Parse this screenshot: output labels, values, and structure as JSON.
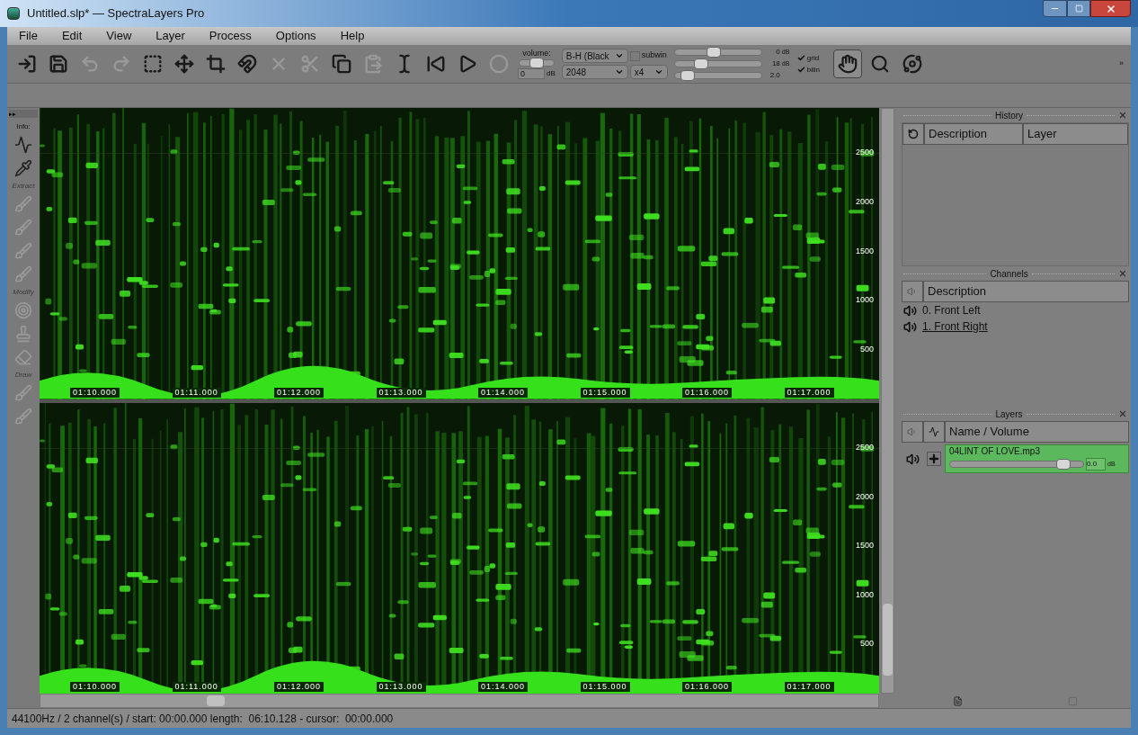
{
  "window": {
    "title": "Untitled.slp* — SpectraLayers Pro"
  },
  "menu": [
    "File",
    "Edit",
    "View",
    "Layer",
    "Process",
    "Options",
    "Help"
  ],
  "toolbar": {
    "buttons": [
      {
        "kind": "import",
        "disabled": false
      },
      {
        "kind": "save",
        "disabled": false
      },
      {
        "kind": "undo",
        "disabled": true
      },
      {
        "kind": "redo",
        "disabled": true
      },
      {
        "kind": "select",
        "disabled": false
      },
      {
        "kind": "move",
        "disabled": false
      },
      {
        "kind": "transform",
        "disabled": false
      },
      {
        "kind": "magnet",
        "disabled": false
      },
      {
        "kind": "delete",
        "disabled": true
      },
      {
        "kind": "cut",
        "disabled": true
      },
      {
        "kind": "copy",
        "disabled": false
      },
      {
        "kind": "paste",
        "disabled": true
      },
      {
        "kind": "cursor",
        "disabled": false
      },
      {
        "kind": "rewind",
        "disabled": false
      },
      {
        "kind": "play",
        "disabled": false
      },
      {
        "kind": "record",
        "disabled": true
      }
    ],
    "volume": {
      "label": "volume:",
      "level": 0.5,
      "value": "0",
      "unit": "dB"
    },
    "colormap": "B-H (Black",
    "fft_size": "2048",
    "overlap": "x4",
    "subwin": {
      "label": "subwin",
      "checked": false
    },
    "sliders": [
      {
        "level": 0.45,
        "value": "0",
        "unit": "dB"
      },
      {
        "level": 0.3,
        "value": "18",
        "unit": "dB"
      },
      {
        "level": 0.15,
        "value": "2.0"
      }
    ],
    "checkboxes": [
      {
        "label": "grid",
        "checked": true
      },
      {
        "label": "bilin",
        "checked": true
      }
    ],
    "tools": [
      {
        "kind": "hand",
        "selected": true
      },
      {
        "kind": "zoom",
        "selected": false
      },
      {
        "kind": "orbit",
        "selected": false
      }
    ],
    "overflow": "»"
  },
  "tool_panel": {
    "expand": "▸▸",
    "sections": [
      {
        "label": "Info:",
        "faded": false,
        "tools": [
          {
            "kind": "spectrum"
          },
          {
            "kind": "dropper"
          }
        ]
      },
      {
        "label": "Extract",
        "faded": true,
        "tools": [
          {
            "kind": "brush"
          },
          {
            "kind": "brush"
          },
          {
            "kind": "brush"
          },
          {
            "kind": "brush"
          }
        ]
      },
      {
        "label": "Modify",
        "faded": true,
        "tools": [
          {
            "kind": "circle"
          },
          {
            "kind": "stamp"
          },
          {
            "kind": "eraser"
          }
        ]
      },
      {
        "label": "Draw",
        "faded": true,
        "tools": [
          {
            "kind": "brush"
          },
          {
            "kind": "brush"
          }
        ]
      }
    ]
  },
  "spectrogram": {
    "channels": [
      {
        "freq_ticks": [
          "2500",
          "2000",
          "1500",
          "1000",
          "500"
        ],
        "time_labels": [
          "01:10.000",
          "01:11.000",
          "01:12.000",
          "01:13.000",
          "01:14.000",
          "01:15.000",
          "01:16.000",
          "01:17.000"
        ]
      },
      {
        "freq_ticks": [
          "2500",
          "2000",
          "1500",
          "1000",
          "500"
        ],
        "time_labels": [
          "01:10.000",
          "01:11.000",
          "01:12.000",
          "01:13.000",
          "01:14.000",
          "01:15.000",
          "01:16.000",
          "01:17.000"
        ]
      }
    ]
  },
  "history": {
    "title": "History",
    "columns": [
      "Description",
      "Layer"
    ]
  },
  "channels_panel": {
    "title": "Channels",
    "columns": [
      "Description"
    ],
    "rows": [
      {
        "label": "0. Front Left",
        "selected": false
      },
      {
        "label": "1. Front Right",
        "selected": true
      }
    ]
  },
  "layers": {
    "title": "Layers",
    "columns": [
      "Name / Volume"
    ],
    "rows": [
      {
        "name": "04LINT OF LOVE.mp3",
        "level": 0.85,
        "value": "0.0",
        "unit": "dB"
      }
    ]
  },
  "status_bar": "44100Hz / 2 channel(s) / start: 00:00.000 length:  06:10.128 - cursor:  00:00.000"
}
